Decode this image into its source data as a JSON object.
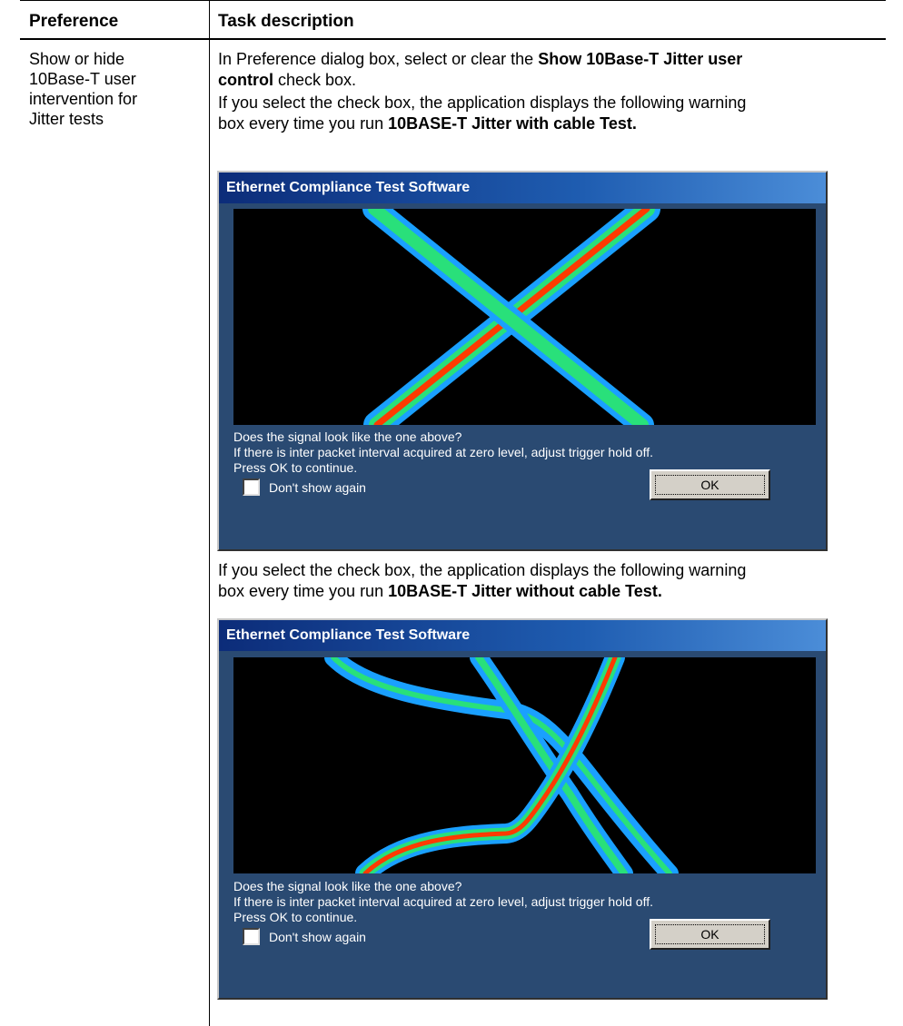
{
  "table": {
    "headers": {
      "preference": "Preference",
      "task": "Task description"
    },
    "row": {
      "preference_lines": [
        "Show or hide",
        "10Base-T user",
        "intervention for",
        "Jitter tests"
      ],
      "para1": {
        "a": "In Preference dialog box, select or clear the ",
        "b": "Show 10Base-T Jitter user",
        "c": "control",
        "d": " check box."
      },
      "para2": {
        "line1": "If you select the check box, the application displays the following warning",
        "a": "box every time you run ",
        "b": "10BASE-T Jitter with cable Test."
      },
      "para3": {
        "line1": "If you select the check box, the application displays the following warning",
        "a": "box every time you run ",
        "b": "10BASE-T Jitter without cable Test."
      }
    }
  },
  "dialogs": [
    {
      "title": "Ethernet Compliance Test Software",
      "message": [
        "Does the signal look like the one above?",
        "If there is inter packet interval acquired at zero level, adjust trigger hold off.",
        "Press OK to continue."
      ],
      "checkbox_label": "Don't show again",
      "checkbox_checked": false,
      "ok_label": "OK"
    },
    {
      "title": "Ethernet Compliance Test Software",
      "message": [
        "Does the signal look like the one above?",
        "If there is inter packet interval acquired at zero level, adjust trigger hold off.",
        "Press OK to continue."
      ],
      "checkbox_label": "Don't show again",
      "checkbox_checked": false,
      "ok_label": "OK"
    }
  ],
  "colors": {
    "dialog_body": "#2a4a72",
    "title_gradient_start": "#0c2c79",
    "title_gradient_end": "#4b8dd8",
    "trace_outer": "#1aa0ff",
    "trace_mid": "#29e07a",
    "trace_core": "#ff3a00"
  }
}
